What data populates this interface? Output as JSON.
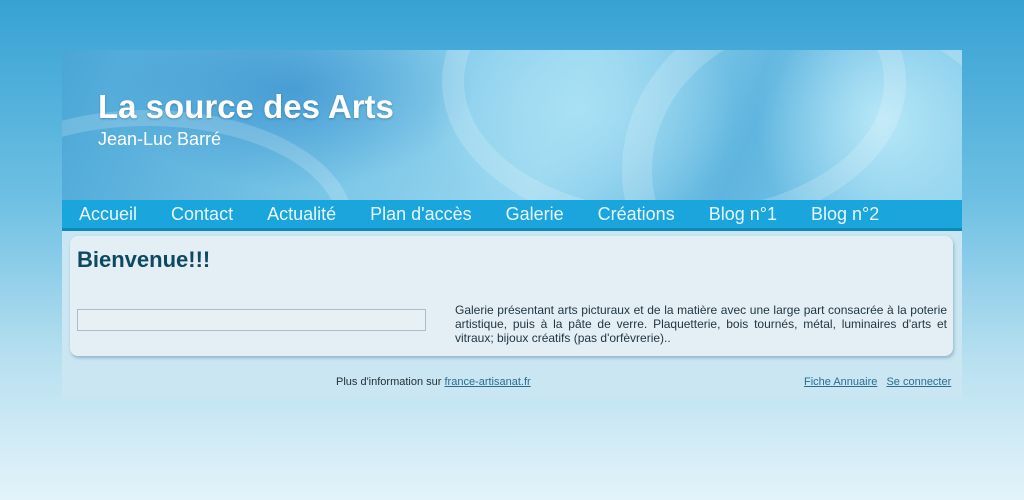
{
  "header": {
    "title": "La source des Arts",
    "subtitle": "Jean-Luc Barré"
  },
  "nav": {
    "items": [
      {
        "label": "Accueil"
      },
      {
        "label": "Contact"
      },
      {
        "label": "Actualité"
      },
      {
        "label": "Plan d'accès"
      },
      {
        "label": "Galerie"
      },
      {
        "label": "Créations"
      },
      {
        "label": "Blog n°1"
      },
      {
        "label": "Blog n°2"
      }
    ]
  },
  "main": {
    "heading": "Bienvenue!!!",
    "search_value": "",
    "description": "Galerie présentant arts picturaux et de la matière avec une large part consacrée à la poterie artistique, puis à la pâte de verre. Plaquetterie, bois tournés, métal, luminaires d'arts et vitraux; bijoux créatifs (pas d'orfèvrerie).."
  },
  "footer": {
    "info_prefix": "Plus d'information sur ",
    "info_link": "france-artisanat.fr",
    "directory_link": "Fiche Annuaire",
    "login_link": "Se connecter"
  },
  "colors": {
    "nav_bar": "#1aa5dc",
    "heading": "#0d4a62",
    "link": "#2a6d93"
  }
}
